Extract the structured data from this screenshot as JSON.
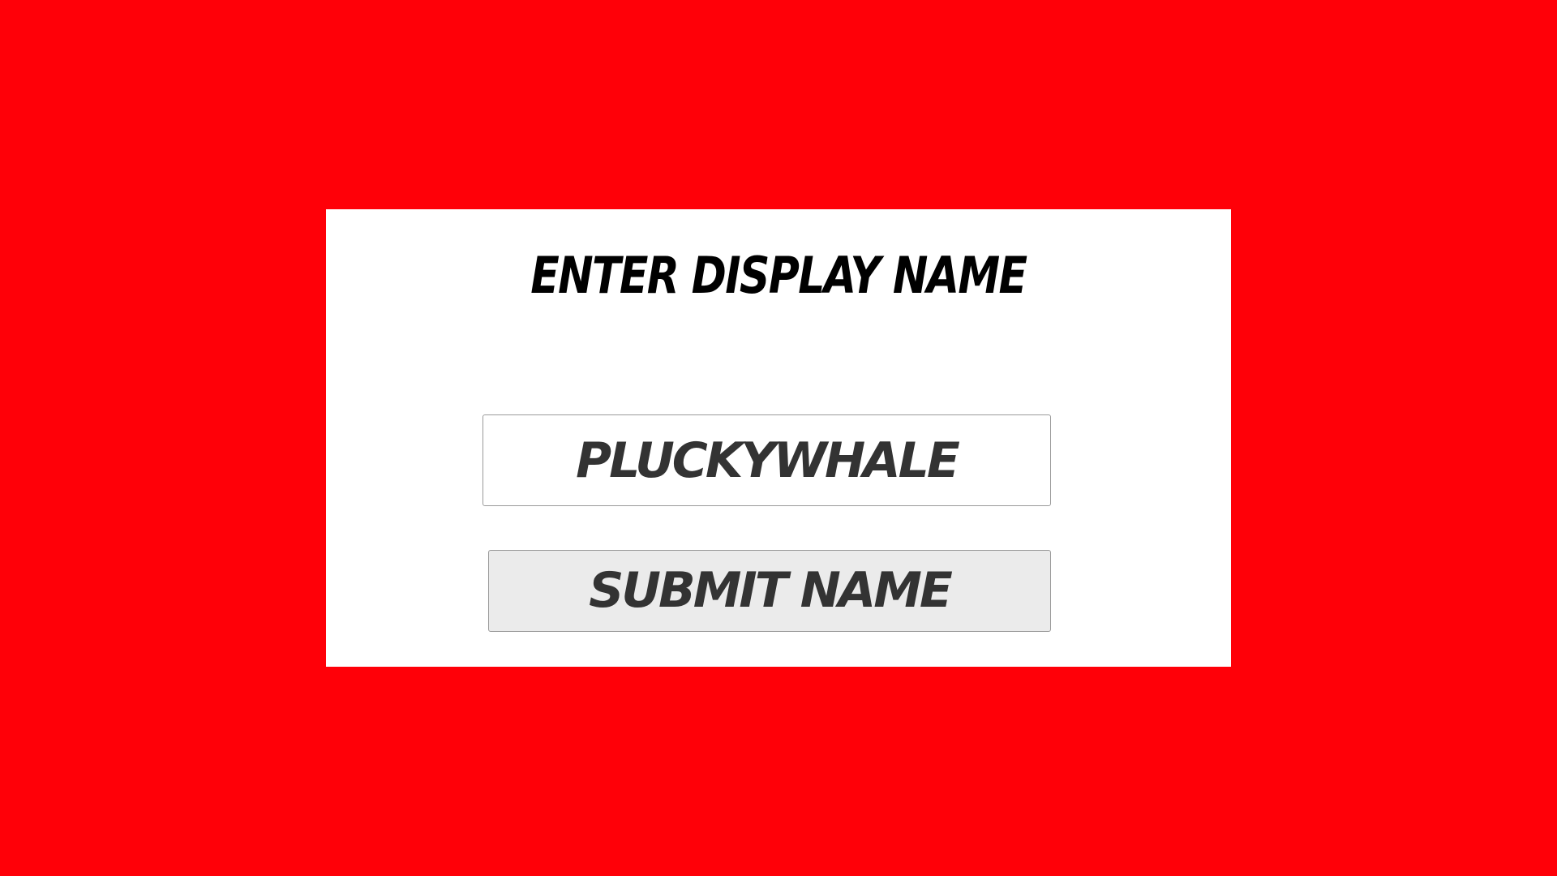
{
  "dialog": {
    "title": "Enter Display Name",
    "name_value": "PluckyWhale",
    "submit_label": "Submit Name"
  },
  "colors": {
    "background": "#ff0008",
    "card": "#ffffff",
    "button": "#ebebeb",
    "text": "#333333"
  }
}
